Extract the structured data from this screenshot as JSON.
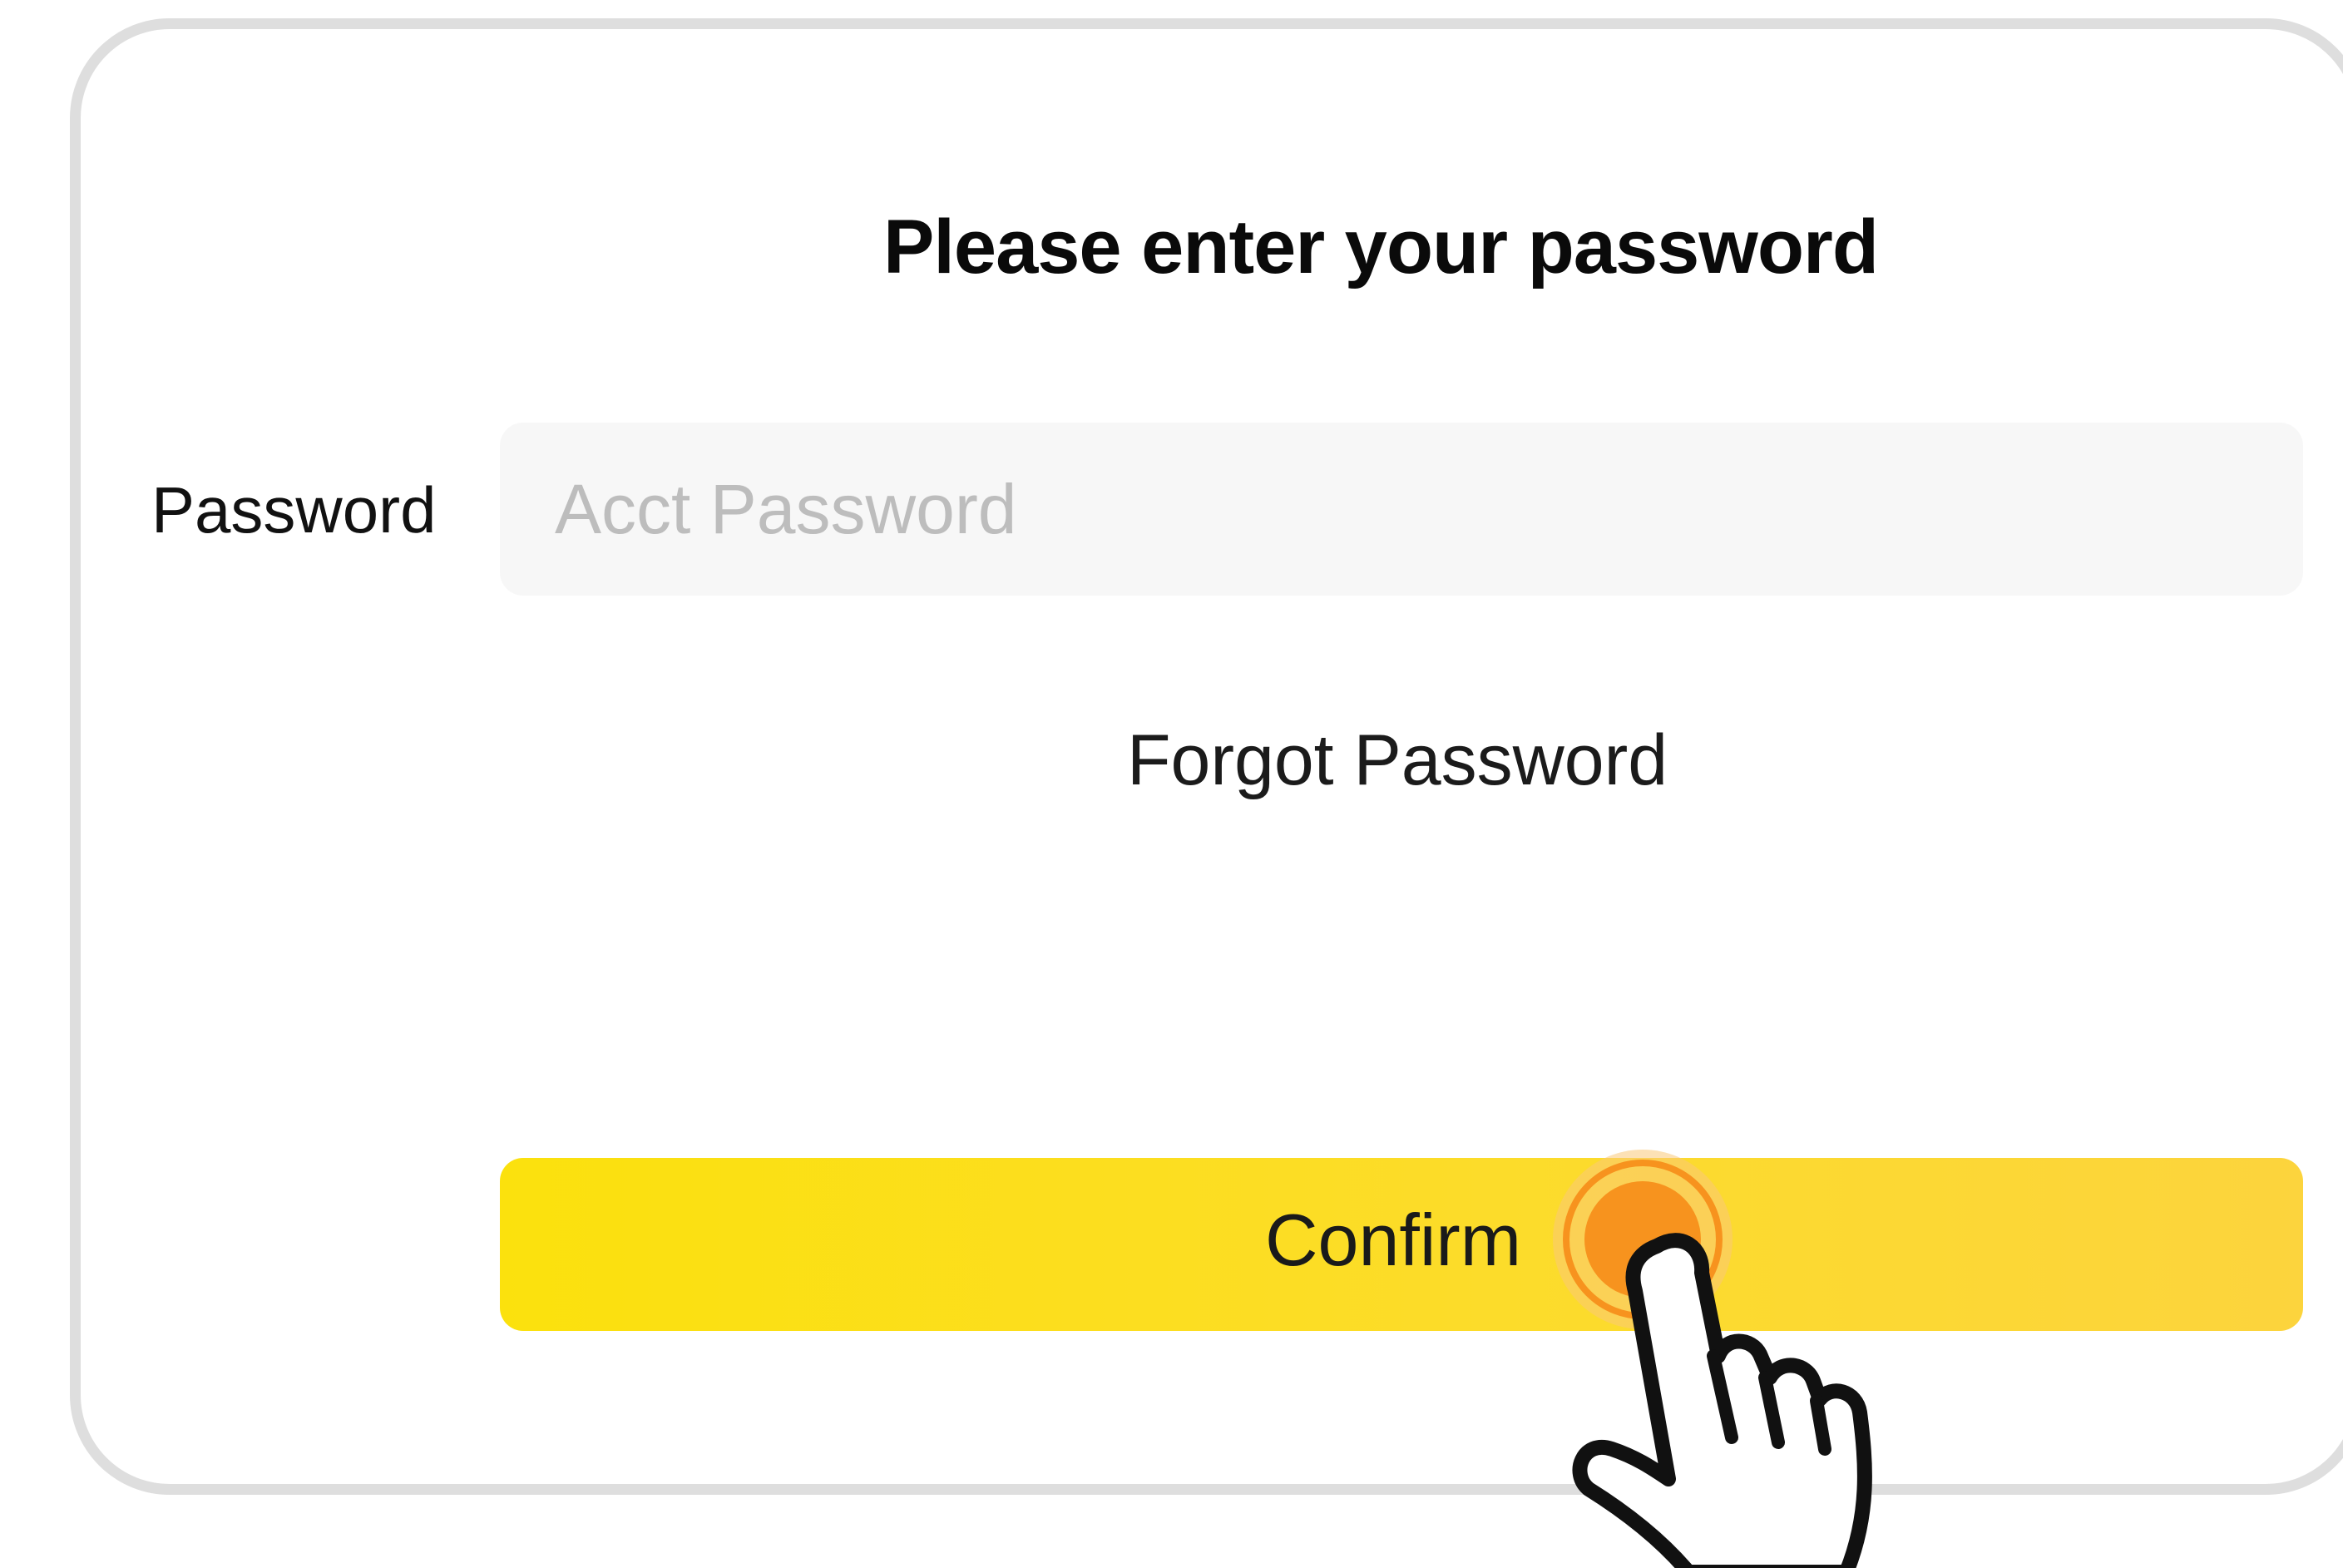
{
  "dialog": {
    "title": "Please enter your password",
    "password_field": {
      "label": "Password",
      "placeholder": "Acct Password",
      "value": ""
    },
    "forgot_link": "Forgot Password",
    "confirm_label": "Confirm"
  },
  "overlay": {
    "tap_indicator_icon": "tap-ripple-icon",
    "cursor_icon": "pointing-hand-icon"
  },
  "colors": {
    "button_yellow": "#fbe10d",
    "tap_orange": "#f7931e",
    "border_gray": "#dedede",
    "input_bg": "#f7f7f7"
  }
}
